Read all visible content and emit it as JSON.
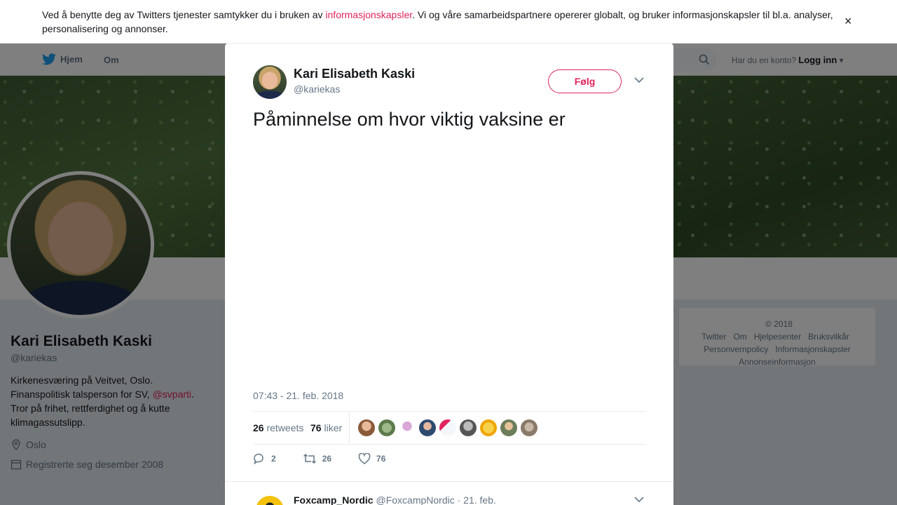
{
  "cookie_banner": {
    "text_before": "Ved å benytte deg av Twitters tjenester samtykker du i bruken av ",
    "link": "informasjonskapsler",
    "text_after": ". Vi og våre samarbeidspartnere opererer globalt, og bruker informasjonskapsler til bl.a. analyser, personalisering og annonser.",
    "close_icon": "close-icon"
  },
  "nav": {
    "home": "Hjem",
    "about": "Om",
    "account_prompt": "Har du en konto?",
    "login": "Logg inn"
  },
  "profile": {
    "name": "Kari Elisabeth Kaski",
    "handle": "@kariekas",
    "bio_1": "Kirkenesværing på Veitvet, Oslo. Finanspolitisk talsperson for SV, ",
    "bio_link": "@svparti",
    "bio_2": ". Tror på frihet, rettferdighet og å kutte klimagassutslipp.",
    "location": "Oslo",
    "joined": "Registrerte seg desember 2008"
  },
  "footer": {
    "links": [
      "© 2018 Twitter",
      "Om",
      "Hjelpesenter",
      "Bruksvilkår",
      "Personvernpolicy",
      "Informasjonskapsler",
      "Annonseinformasjon"
    ]
  },
  "tweet": {
    "author_name": "Kari Elisabeth Kaski",
    "author_handle": "@kariekas",
    "follow_label": "Følg",
    "text": "Påminnelse om hvor viktig vaksine er",
    "timestamp": "07:43 - 21. feb. 2018",
    "retweets_count": "26",
    "retweets_label": "retweets",
    "likes_count": "76",
    "likes_label": "liker",
    "reply_count": "2",
    "retweet_count": "26",
    "like_count": "76"
  },
  "reply": {
    "name": "Foxcamp_Nordic",
    "handle": "@FoxcampNordic",
    "date": "· 21. feb."
  },
  "colors": {
    "accent": "#e0245e",
    "twitter_blue": "#1da1f2",
    "muted": "#657786"
  }
}
